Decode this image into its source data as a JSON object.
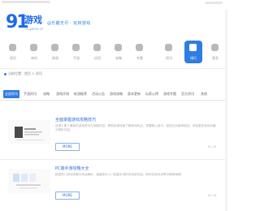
{
  "header": {
    "logo_number": "91",
    "logo_text": "游戏",
    "logo_sub": "91game.cn",
    "slogan": "@乐趣无尽 · 玩转游戏"
  },
  "nav": {
    "items": [
      {
        "label": "首页",
        "icon": "home-icon"
      },
      {
        "label": "单机",
        "icon": "gamepad-icon"
      },
      {
        "label": "网游",
        "icon": "globe-icon"
      },
      {
        "label": "手游",
        "icon": "phone-icon"
      },
      {
        "label": "应用",
        "icon": "grid-icon"
      },
      {
        "label": "攻略",
        "icon": "book-icon"
      },
      {
        "label": "专题",
        "icon": "star-icon"
      },
      {
        "label": "资讯",
        "icon": "news-icon"
      },
      {
        "label": "排行",
        "icon": "chart-icon"
      },
      {
        "label": "更多",
        "icon": "more-icon"
      }
    ],
    "active_index": 8
  },
  "breadcrumb": "当前位置：首页 > 资讯",
  "tabs": {
    "items": [
      "全部资讯",
      "手游资讯",
      "攻略",
      "游戏评测",
      "新游推荐",
      "活动公告",
      "游戏攻略",
      "版本更新",
      "玩家心得",
      "游戏专题",
      "官方资讯",
      "其他"
    ],
    "active_index": 0
  },
  "articles": [
    {
      "title": "全面掌握游戏攻略技巧",
      "desc": "这里汇集了最新的游戏资讯与攻略内容，帮助玩家快速了解游戏玩法，掌握核心技巧，轻松应对各种挑战，体验更多游戏乐趣与精彩内容。",
      "more": "MORE",
      "date": "01-15"
    },
    {
      "title": "PC端手游攻略大全",
      "desc": "精选热门游戏攻略与玩法解析，涵盖新手入门到高手进阶的全部内容，助你在游戏世界中畅快驰骋。",
      "more": "MORE",
      "date": "01-14"
    }
  ]
}
